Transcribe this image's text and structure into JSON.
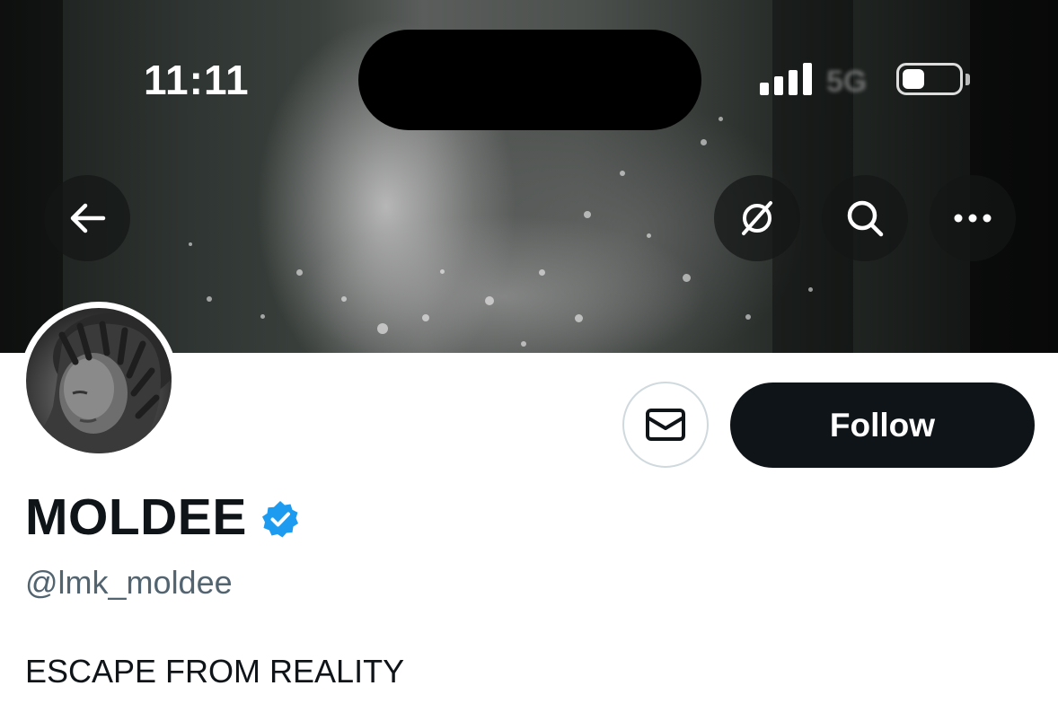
{
  "status_bar": {
    "time": "11:11",
    "network": "5G"
  },
  "header": {
    "back_icon": "arrow-left-icon",
    "grok_icon": "slashed-circle-icon",
    "search_icon": "search-icon",
    "more_icon": "more-horizontal-icon"
  },
  "profile": {
    "display_name": "MOLDEE",
    "verified": true,
    "verified_color": "#1d9bf0",
    "handle": "@lmk_moldee",
    "bio": "ESCAPE FROM REALITY"
  },
  "actions": {
    "message_icon": "envelope-icon",
    "follow_label": "Follow"
  },
  "colors": {
    "primary_text": "#0f1419",
    "secondary_text": "#536471",
    "follow_bg": "#0f1419"
  }
}
